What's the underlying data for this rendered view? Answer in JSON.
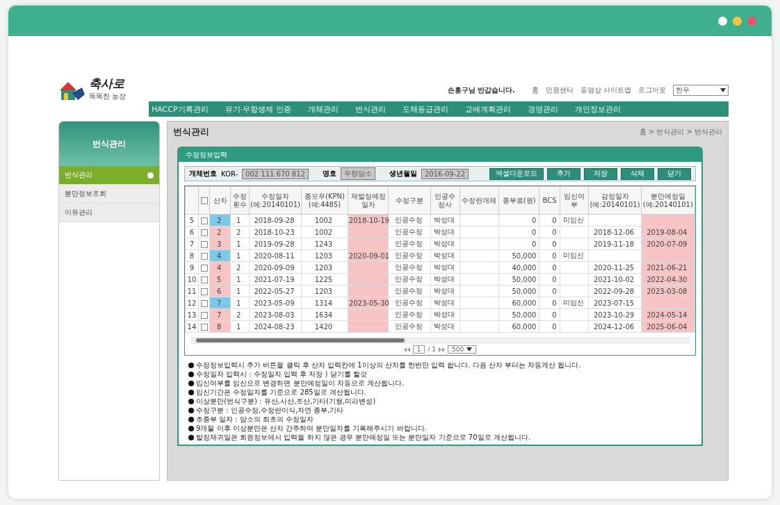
{
  "window": {
    "dots": [
      {
        "color": "#ffffff"
      },
      {
        "color": "#f5c542"
      },
      {
        "color": "#f0506e"
      }
    ]
  },
  "header": {
    "logo_text": "축사로",
    "logo_sub": "똑똑한 농장",
    "greeting": "손흥구님 반갑습니다.",
    "links": [
      "홈",
      "민원센터",
      "동영상 사이트맵",
      "로그아웃"
    ],
    "species_select": "한우"
  },
  "nav": [
    "HACCP기록관리",
    "유기·무항생제 인증",
    "개체관리",
    "번식관리",
    "도체등급관리",
    "교배계획관리",
    "경영관리",
    "개인정보관리"
  ],
  "sidebar": {
    "title": "번식관리",
    "items": [
      {
        "label": "번식관리",
        "selected": true
      },
      {
        "label": "분만정보조회",
        "selected": false
      },
      {
        "label": "이유관리",
        "selected": false
      }
    ]
  },
  "panel": {
    "title": "번식관리",
    "breadcrumb": "홈 > 번식관리 > 번식관리"
  },
  "modal": {
    "title": "수정정보입력",
    "fields": [
      {
        "label": "개체번호",
        "prefix": "KOR-",
        "value": "002 111 670 812"
      },
      {
        "label": "명호",
        "value": "우량암소"
      },
      {
        "label": "생년월일",
        "value": "2016-09-22"
      }
    ],
    "buttons": [
      "엑셀다운로드",
      "추가",
      "저장",
      "삭제",
      "닫기"
    ],
    "header_checkbox": {
      "checked": false
    },
    "columns": [
      {
        "label": "산차"
      },
      {
        "label": "수정횟수"
      },
      {
        "label": "수정일자",
        "sub": "(예:20140101)"
      },
      {
        "label": "종모우(KPN)",
        "sub": "(예:4485)"
      },
      {
        "label": "재발정예정일자"
      },
      {
        "label": "수정구분"
      },
      {
        "label": "인공수정사"
      },
      {
        "label": "수정란개체"
      },
      {
        "label": "종부료(원)"
      },
      {
        "label": "BCS"
      },
      {
        "label": "임신여부"
      },
      {
        "label": "감정일자",
        "sub": "(예:20140101)"
      },
      {
        "label": "분만예정일",
        "sub": "(예:20140101)"
      }
    ],
    "rows": [
      {
        "no": "5",
        "checked": false,
        "color": "#7cc8e8",
        "cells": [
          "2",
          "1",
          "2018-09-28",
          "1002",
          "2018-10-19",
          "인공수정",
          "박성대",
          null,
          "0",
          "0",
          "미임신",
          null,
          null
        ]
      },
      {
        "no": "6",
        "checked": false,
        "color": "#f6c4c4",
        "cells": [
          "2",
          "2",
          "2018-10-23",
          "1002",
          null,
          "인공수정",
          "박성대",
          null,
          "0",
          "0",
          null,
          "2018-12-06",
          "2019-08-04"
        ]
      },
      {
        "no": "7",
        "checked": false,
        "color": "#f6c4c4",
        "cells": [
          "3",
          "1",
          "2019-09-28",
          "1243",
          null,
          "인공수정",
          "박성대",
          null,
          "0",
          "0",
          null,
          "2019-11-18",
          "2020-07-09"
        ]
      },
      {
        "no": "8",
        "checked": false,
        "color": "#7cc8e8",
        "cells": [
          "4",
          "1",
          "2020-08-11",
          "1203",
          "2020-09-01",
          "인공수정",
          "박성대",
          null,
          "50,000",
          "0",
          "미임신",
          null,
          null
        ]
      },
      {
        "no": "9",
        "checked": false,
        "color": "#f6c4c4",
        "cells": [
          "4",
          "2",
          "2020-09-09",
          "1203",
          null,
          "인공수정",
          "박성대",
          null,
          "40,000",
          "0",
          null,
          "2020-11-25",
          "2021-06-21"
        ]
      },
      {
        "no": "10",
        "checked": false,
        "color": "#f6c4c4",
        "cells": [
          "5",
          "1",
          "2021-07-19",
          "1225",
          null,
          "인공수정",
          "박성대",
          null,
          "50,000",
          "0",
          null,
          "2021-10-02",
          "2022-04-30"
        ]
      },
      {
        "no": "11",
        "checked": false,
        "color": "#f6c4c4",
        "cells": [
          "6",
          "1",
          "2022-05-27",
          "1203",
          null,
          "인공수정",
          "박성대",
          null,
          "50,000",
          "0",
          null,
          "2022-09-28",
          "2023-03-08"
        ]
      },
      {
        "no": "12",
        "checked": false,
        "color": "#7cc8e8",
        "cells": [
          "7",
          "1",
          "2023-05-09",
          "1314",
          "2023-05-30",
          "인공수정",
          "박성대",
          null,
          "60,000",
          "0",
          "미임신",
          "2023-07-15",
          null
        ]
      },
      {
        "no": "13",
        "checked": false,
        "color": "#f6c4c4",
        "cells": [
          "7",
          "2",
          "2023-08-03",
          "1634",
          null,
          "인공수정",
          "박성대",
          null,
          "50,000",
          "0",
          null,
          "2023-10-29",
          "2024-05-14"
        ]
      },
      {
        "no": "14",
        "checked": false,
        "color": "#f6c4c4",
        "cells": [
          "8",
          "1",
          "2024-08-23",
          "1420",
          null,
          "인공수정",
          "박성대",
          null,
          "60,000",
          "0",
          null,
          "2024-12-06",
          "2025-06-04"
        ]
      }
    ],
    "pager": {
      "page": "1",
      "total": "/ 1",
      "size": "500"
    },
    "notes": [
      "수정정보입력시 추가 버튼을 클릭 후 산차 입력칸에 1이상의 산차를 한번만 입력 합니다. 다음 산차 부터는 자동계산 됩니다.",
      "수정일자 입력시 : 수정일자 입력 후 저장 ) 닫기를 할것",
      "임신여부를 임신으로 변경하면 분만예정일이 자동으로 계산됩니다.",
      "임신기간은 수정일자를 기준으로 285일로 계산됩니다.",
      "이상분만(번식구분) : 유산,사산,조산,기타(기형,미라변성)",
      "수정구분 : 인공수정,수정란이식,자연 종부,기타",
      "초종부 일자 : 암소의 최초의 수정일자",
      "9개월 이후 이상분만은 산차 간주하여 분만일자를 기록해주시기 바랍니다.",
      "발정재귀일은 회원정보에서 입력을 하지 않은 경우 분만예정일 또는 분만일자 기준으로 70일로 계산됩니다."
    ]
  }
}
